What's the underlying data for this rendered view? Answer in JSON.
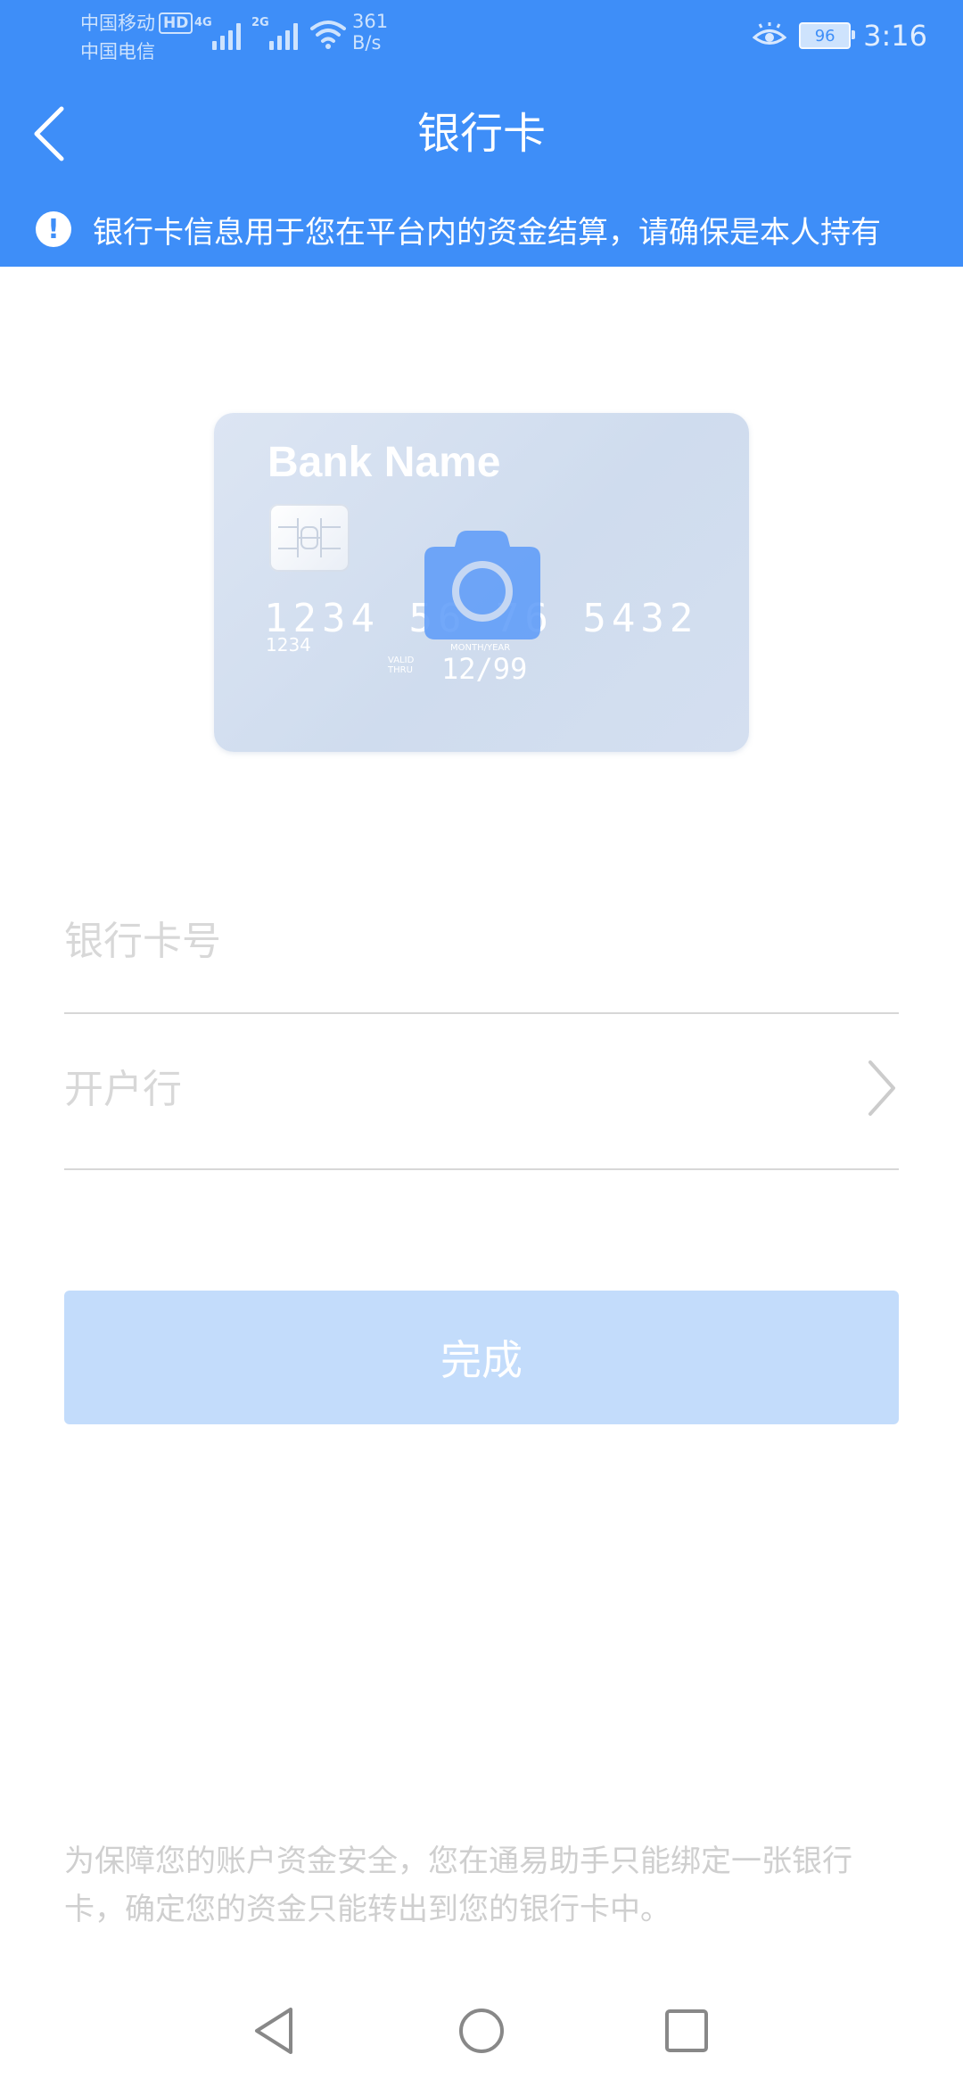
{
  "status_bar": {
    "carrier_1": "中国移动",
    "hd_badge": "HD",
    "carrier_2": "中国电信",
    "network_1": "4G",
    "network_2": "2G",
    "speed_value": "361",
    "speed_unit": "B/s",
    "battery": "96",
    "time": "3:16"
  },
  "header": {
    "back_icon": "chevron-left-icon",
    "title": "银行卡"
  },
  "notice": {
    "icon": "exclamation-circle-icon",
    "text": "银行卡信息用于您在平台内的资金结算，请确保是本人持有"
  },
  "card_sample": {
    "bank_name": "Bank Name",
    "number": "1234 56  76 5432",
    "small_number": "1234",
    "valid_thru": "VALID THRU",
    "month_year": "MONTH/YEAR",
    "expiry": "12/99",
    "camera_icon": "camera-icon"
  },
  "form": {
    "card_number_placeholder": "银行卡号",
    "bank_placeholder": "开户行"
  },
  "actions": {
    "done_label": "完成"
  },
  "footer": {
    "security_note": "为保障您的账户资金安全，您在通易助手只能绑定一张银行卡，确定您的资金只能转出到您的银行卡中。"
  },
  "colors": {
    "primary": "#3e8ef8",
    "button_disabled": "#c3dcfb",
    "placeholder": "#d8d8d8",
    "note_text": "#cfcfcf"
  }
}
